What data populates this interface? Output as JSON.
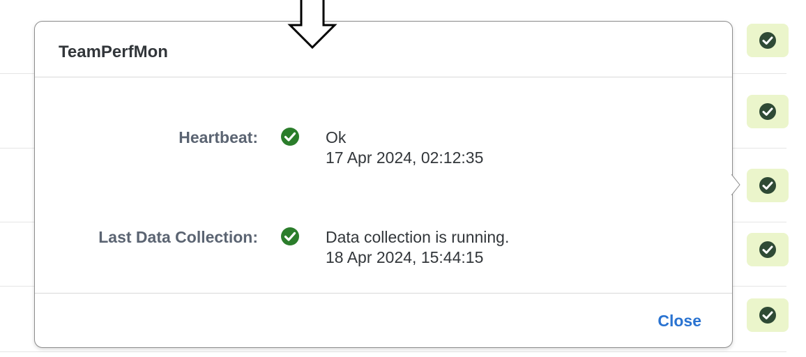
{
  "popover": {
    "title": "TeamPerfMon",
    "fields": [
      {
        "label": "Heartbeat:",
        "icon": "check-circle-icon",
        "status": "Ok",
        "timestamp": "17 Apr 2024, 02:12:35"
      },
      {
        "label": "Last Data Collection:",
        "icon": "check-circle-icon",
        "status": "Data collection is running.",
        "timestamp": "18 Apr 2024, 15:44:15"
      }
    ],
    "close_label": "Close"
  },
  "background_rows": {
    "status_icons": [
      "check-circle-icon",
      "check-circle-icon",
      "check-circle-icon",
      "check-circle-icon",
      "check-circle-icon"
    ]
  },
  "colors": {
    "success": "#2b7d2b",
    "chip_bg": "#ebf5cb",
    "link": "#2a73d1",
    "label": "#5b6472",
    "text": "#32363a"
  }
}
